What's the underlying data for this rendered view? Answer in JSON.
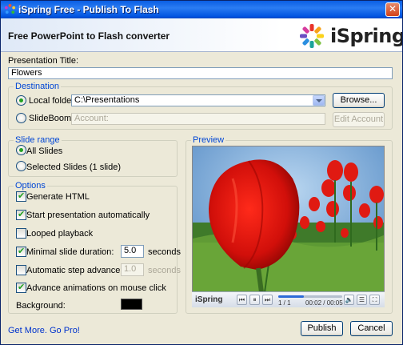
{
  "window": {
    "title": "iSpring Free - Publish To Flash",
    "close_glyph": "✕"
  },
  "header": {
    "title": "Free PowerPoint to Flash converter",
    "logo_text": "iSpring"
  },
  "presentation": {
    "label": "Presentation Title:",
    "value": "Flowers"
  },
  "destination": {
    "title": "Destination",
    "local_label": "Local folder",
    "local_path": "C:\\Presentations",
    "browse_label": "Browse...",
    "slideboom_label": "SlideBoom",
    "account_placeholder": "Account:",
    "edit_account_label": "Edit Account",
    "selected": "Local folder"
  },
  "slide_range": {
    "title": "Slide range",
    "all_label": "All Slides",
    "selected_label": "Selected Slides (1 slide)",
    "selected": "All Slides"
  },
  "options": {
    "title": "Options",
    "generate_html": {
      "label": "Generate HTML",
      "checked": true
    },
    "start_auto": {
      "label": "Start presentation automatically",
      "checked": true
    },
    "looped": {
      "label": "Looped playback",
      "checked": false
    },
    "min_duration": {
      "label": "Minimal slide duration:",
      "checked": true,
      "value": "5.0",
      "unit": "seconds"
    },
    "auto_advance": {
      "label": "Automatic step advance time:",
      "checked": false,
      "value": "1.0",
      "unit": "seconds"
    },
    "advance_anim": {
      "label": "Advance animations on mouse click",
      "checked": true
    },
    "background_label": "Background:",
    "background_color": "#000000"
  },
  "preview": {
    "title": "Preview",
    "player_logo": "iSpring",
    "slide_counter": "1 / 1",
    "time": "00:02 / 00:05",
    "progress": 0.4
  },
  "footer": {
    "link": "Get More. Go Pro!",
    "publish_label": "Publish",
    "cancel_label": "Cancel"
  },
  "colors": {
    "titlebar": "#0a5ee3",
    "group_title": "#0046d5",
    "link": "#0033cc",
    "check": "#21a121"
  }
}
